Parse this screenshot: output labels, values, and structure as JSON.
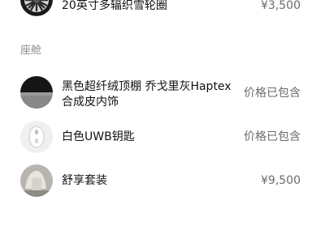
{
  "items_top": [
    {
      "name": "20英寸多辐织雪轮圈",
      "price": "¥3,500",
      "icon": "wheel-rim-icon"
    }
  ],
  "section": {
    "title": "座舱"
  },
  "cabin_items": [
    {
      "name_line1": "黑色超纤绒顶棚 乔戈里灰Haptex",
      "name_line2": "合成皮内饰",
      "price": "价格已包含",
      "icon": "interior-swatch-icon"
    },
    {
      "name": "白色UWB钥匙",
      "price": "价格已包含",
      "icon": "key-fob-icon"
    },
    {
      "name": "舒享套装",
      "price": "¥9,500",
      "icon": "seat-icon"
    }
  ],
  "colors": {
    "text": "#111111",
    "muted": "#6b6b6b",
    "section": "#8c8c8c",
    "background": "#ffffff"
  }
}
